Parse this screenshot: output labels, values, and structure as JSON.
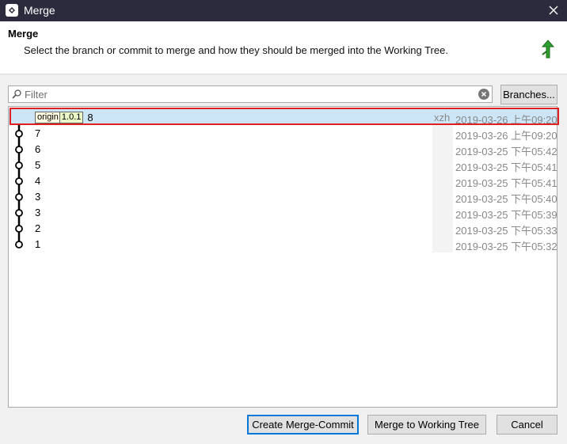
{
  "window": {
    "title": "Merge"
  },
  "header": {
    "title": "Merge",
    "description": "Select the branch or commit to merge and how they should be merged into the Working Tree."
  },
  "filter": {
    "placeholder": "Filter",
    "value": ""
  },
  "buttons": {
    "branches": "Branches...",
    "create_merge_commit": "Create Merge-Commit",
    "merge_to_working_tree": "Merge to Working Tree",
    "cancel": "Cancel"
  },
  "commits": [
    {
      "branch": "origin",
      "version": "1.0.1",
      "message": "8",
      "author": "xzh",
      "date": "2019-03-26 上午09:20",
      "selected": true
    },
    {
      "message": "7",
      "author": "",
      "date": "2019-03-26 上午09:20"
    },
    {
      "message": "6",
      "author": "",
      "date": "2019-03-25 下午05:42"
    },
    {
      "message": "5",
      "author": "",
      "date": "2019-03-25 下午05:41"
    },
    {
      "message": "4",
      "author": "",
      "date": "2019-03-25 下午05:41"
    },
    {
      "message": "3",
      "author": "",
      "date": "2019-03-25 下午05:40"
    },
    {
      "message": "3",
      "author": "",
      "date": "2019-03-25 下午05:39"
    },
    {
      "message": "2",
      "author": "",
      "date": "2019-03-25 下午05:33"
    },
    {
      "message": "1",
      "author": "",
      "date": "2019-03-25 下午05:32"
    }
  ],
  "icons": {
    "app": "smartgit-logo-icon",
    "close": "close-icon",
    "header": "merge-arrow-icon",
    "search": "search-icon",
    "clear": "clear-icon"
  },
  "colors": {
    "titlebar": "#2b2b3d",
    "selection": "#cde6f7",
    "highlight": "#e02020",
    "merge_icon": "#2e9e2e"
  }
}
